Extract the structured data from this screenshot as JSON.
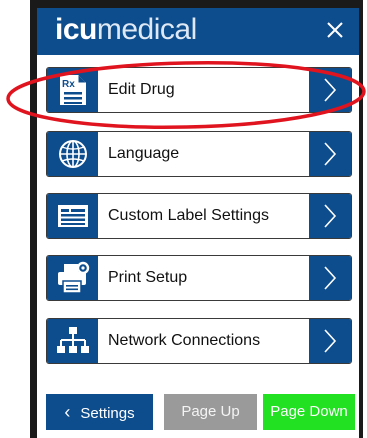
{
  "header": {
    "logo_bold": "icu",
    "logo_light": "medical",
    "close_icon": "close-icon"
  },
  "menu": {
    "items": [
      {
        "label": "Edit Drug",
        "icon": "rx-document-icon"
      },
      {
        "label": "Language",
        "icon": "globe-icon"
      },
      {
        "label": "Custom Label Settings",
        "icon": "label-card-icon"
      },
      {
        "label": "Print Setup",
        "icon": "printer-gear-icon"
      },
      {
        "label": "Network Connections",
        "icon": "network-tree-icon"
      }
    ],
    "arrow_icon": "chevron-right-icon"
  },
  "footer": {
    "settings_label": "Settings",
    "page_up_label": "Page Up",
    "page_down_label": "Page Down"
  },
  "colors": {
    "brand_blue": "#0d4d8e",
    "page_up_gray": "#9a9a9a",
    "page_down_green": "#22e022",
    "annotation_red": "#e0141e"
  },
  "annotation": {
    "highlighted_item": "Edit Drug"
  }
}
